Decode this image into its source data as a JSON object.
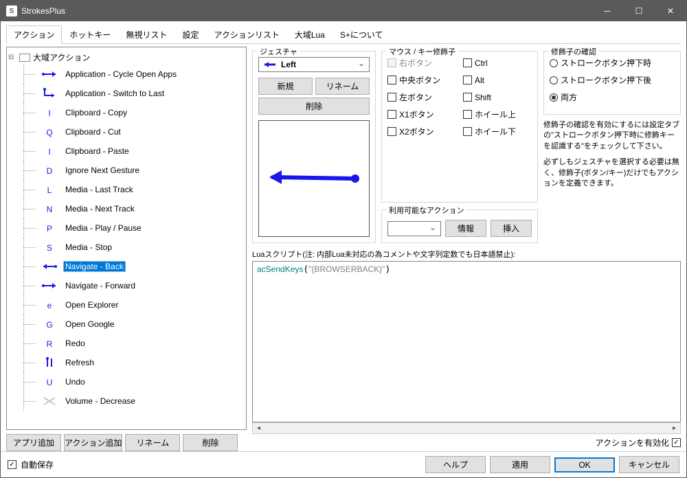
{
  "window": {
    "title": "StrokesPlus"
  },
  "tabs": [
    "アクション",
    "ホットキー",
    "無視リスト",
    "設定",
    "アクションリスト",
    "大域Lua",
    "S+について"
  ],
  "active_tab": 0,
  "tree": {
    "root": "大域アクション",
    "items": [
      {
        "label": "Application - Cycle Open Apps",
        "g": "right"
      },
      {
        "label": "Application - Switch to Last",
        "g": "down-right"
      },
      {
        "label": "Clipboard - Copy",
        "g": "I"
      },
      {
        "label": "Clipboard - Cut",
        "g": "Q"
      },
      {
        "label": "Clipboard - Paste",
        "g": "I"
      },
      {
        "label": "Ignore Next Gesture",
        "g": "D"
      },
      {
        "label": "Media - Last Track",
        "g": "L"
      },
      {
        "label": "Media - Next Track",
        "g": "N"
      },
      {
        "label": "Media - Play / Pause",
        "g": "P"
      },
      {
        "label": "Media - Stop",
        "g": "S"
      },
      {
        "label": "Navigate - Back",
        "g": "left",
        "sel": true
      },
      {
        "label": "Navigate - Forward",
        "g": "right"
      },
      {
        "label": "Open Explorer",
        "g": "e"
      },
      {
        "label": "Open Google",
        "g": "G"
      },
      {
        "label": "Redo",
        "g": "R"
      },
      {
        "label": "Refresh",
        "g": "down-up"
      },
      {
        "label": "Undo",
        "g": "U"
      },
      {
        "label": "Volume - Decrease",
        "g": "X"
      }
    ]
  },
  "left_buttons": {
    "add_app": "アプリ追加",
    "add_action": "アクション追加",
    "rename": "リネーム",
    "delete": "削除"
  },
  "gesture": {
    "title": "ジェスチャ",
    "selected": "Left",
    "new": "新規",
    "rename": "リネーム",
    "delete": "削除"
  },
  "mods": {
    "title": "マウス / キー修飾子",
    "right": "右ボタン",
    "ctrl": "Ctrl",
    "middle": "中央ボタン",
    "alt": "Alt",
    "left_btn": "左ボタン",
    "shift": "Shift",
    "x1": "X1ボタン",
    "wheel_up": "ホイール上",
    "x2": "X2ボタン",
    "wheel_down": "ホイール下",
    "avail_title": "利用可能なアクション",
    "info": "情報",
    "insert": "挿入"
  },
  "check": {
    "title": "修飾子の確認",
    "r1": "ストロークボタン押下時",
    "r2": "ストロークボタン押下後",
    "r3": "両方",
    "help1": "修飾子の確認を有効にするには設定タブの\"ストロークボタン押下時に修飾キーを認識する\"をチェックして下さい。",
    "help2": "必ずしもジェスチャを選択する必要は無く、修飾子(ボタン/キー)だけでもアクションを定義できます。"
  },
  "script": {
    "label": "Luaスクリプト(注: 内部Lua未対応の為コメントや文字列定数でも日本語禁止):",
    "fn": "acSendKeys",
    "arg": "\"{BROWSERBACK}\""
  },
  "enable_action": "アクションを有効化",
  "footer": {
    "autosave": "自動保存",
    "help": "ヘルプ",
    "apply": "適用",
    "ok": "OK",
    "cancel": "キャンセル"
  }
}
